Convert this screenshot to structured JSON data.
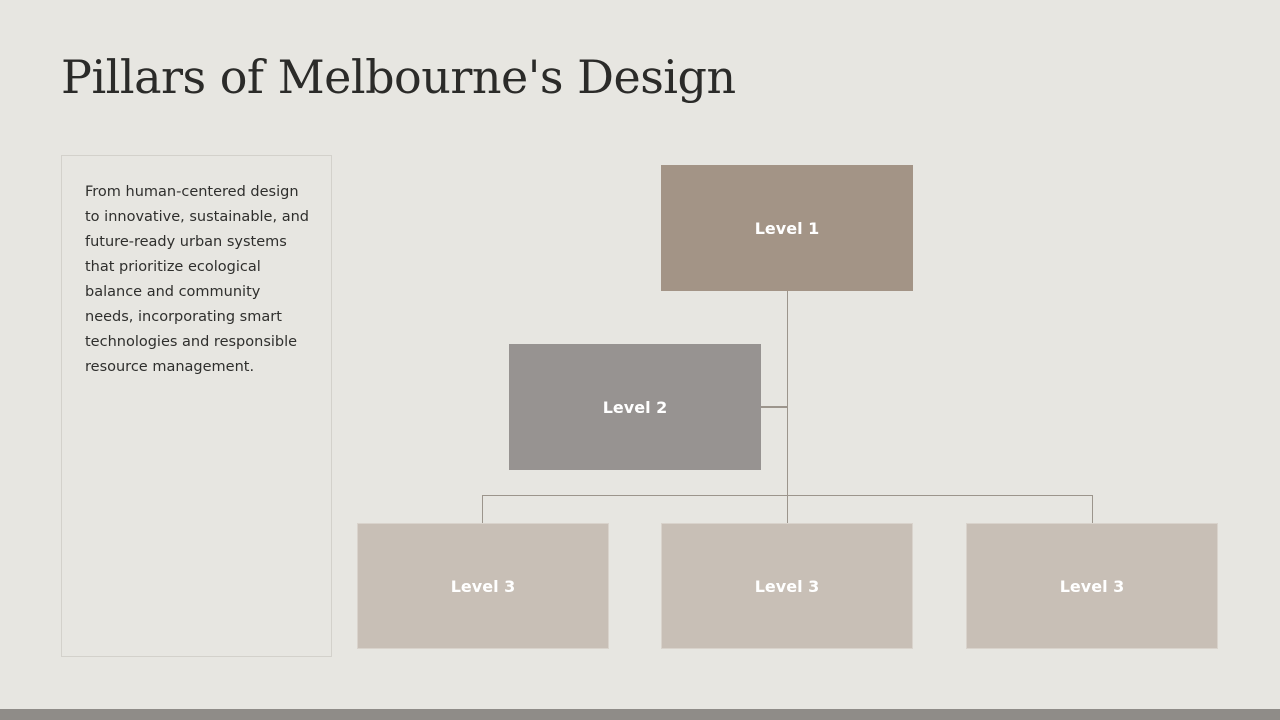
{
  "slide": {
    "title": "Pillars of Melbourne's Design",
    "description": "From human-centered design to innovative, sustainable, and future-ready urban systems that prioritize ecological balance and community needs, incorporating smart technologies and responsible resource management."
  },
  "org_chart": {
    "level1": {
      "label": "Level 1",
      "color": "#a39486"
    },
    "level2": {
      "label": "Level 2",
      "color": "#979391"
    },
    "level3": [
      {
        "label": "Level 3",
        "color": "#c8bfb6"
      },
      {
        "label": "Level 3",
        "color": "#c8bfb6"
      },
      {
        "label": "Level 3",
        "color": "#c8bfb6"
      }
    ],
    "connector_color": "#9c958c"
  },
  "footer": {
    "bar_color": "#8f8c88"
  }
}
